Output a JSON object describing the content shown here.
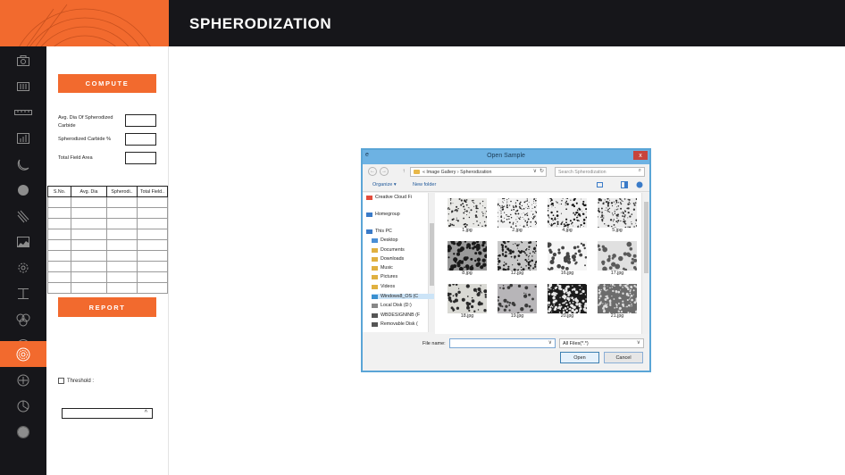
{
  "header": {
    "title": "SPHERODIZATION"
  },
  "colors": {
    "accent": "#f26a2e",
    "dark": "#16161a"
  },
  "rail": {
    "items": [
      {
        "name": "camera-icon"
      },
      {
        "name": "sliders-icon"
      },
      {
        "name": "ruler-icon"
      },
      {
        "name": "bar-chart-icon"
      },
      {
        "name": "crescent-icon"
      },
      {
        "name": "filled-circle-icon"
      },
      {
        "name": "diagonal-lines-icon"
      },
      {
        "name": "area-chart-icon"
      },
      {
        "name": "gear-icon"
      },
      {
        "name": "measure-icon"
      },
      {
        "name": "circles-icon"
      },
      {
        "name": "ring-circle-icon"
      },
      {
        "name": "spheroid-icon",
        "active": true
      },
      {
        "name": "crosshair-icon"
      },
      {
        "name": "pie-chart-icon"
      },
      {
        "name": "dot-circle-icon"
      }
    ]
  },
  "panel": {
    "compute_label": "COMPUTE",
    "avg_dia_label": "Avg. Dia Of Spherodized Carbide",
    "carbide_pct_label": "Spherodized Carbide %",
    "total_field_label": "Total Field Area",
    "table": {
      "headers": [
        "S.No.",
        "Avg. Dia",
        "Spherodi..",
        "Total Field.."
      ],
      "rows": [
        [
          "",
          "",
          "",
          ""
        ],
        [
          "",
          "",
          "",
          ""
        ],
        [
          "",
          "",
          "",
          ""
        ],
        [
          "",
          "",
          "",
          ""
        ],
        [
          "",
          "",
          "",
          ""
        ],
        [
          "",
          "",
          "",
          ""
        ],
        [
          "",
          "",
          "",
          ""
        ],
        [
          "",
          "",
          "",
          ""
        ],
        [
          "",
          "",
          "",
          ""
        ]
      ]
    },
    "report_label": "REPORT",
    "threshold_label": "Threshold :",
    "combo_caret": "^"
  },
  "dialog": {
    "title": "Open Sample",
    "system_glyph": "e",
    "close_label": "x",
    "nav": {
      "back": "←",
      "forward": "→",
      "up": "↑"
    },
    "address": "«  Image Gallery  ›  Spherodization",
    "address_dropdown": "∨",
    "address_refresh": "↻",
    "search_placeholder": "Search Spherodization",
    "search_icon": "⌕",
    "organize_label": "Organize ▾",
    "new_folder_label": "New folder",
    "tree": [
      {
        "label": "Creative Cloud Fi",
        "icon": "cloud-icon",
        "color": "#e34c3c"
      },
      {
        "label": "Homegroup",
        "icon": "homegroup-icon",
        "color": "#3a7bc8"
      },
      {
        "label": "This PC",
        "icon": "computer-icon",
        "color": "#3a7bc8"
      },
      {
        "label": "Desktop",
        "icon": "folder-icon",
        "color": "#4a8fd6"
      },
      {
        "label": "Documents",
        "icon": "folder-icon",
        "color": "#e0b040"
      },
      {
        "label": "Downloads",
        "icon": "folder-icon",
        "color": "#e0b040"
      },
      {
        "label": "Music",
        "icon": "folder-icon",
        "color": "#e0b040"
      },
      {
        "label": "Pictures",
        "icon": "folder-icon",
        "color": "#e0b040"
      },
      {
        "label": "Videos",
        "icon": "folder-icon",
        "color": "#e0b040"
      },
      {
        "label": "Windows8_OS (C",
        "icon": "drive-icon",
        "color": "#3a8fd0",
        "selected": true
      },
      {
        "label": "Local Disk (D:)",
        "icon": "drive-icon",
        "color": "#888888"
      },
      {
        "label": "WBDESIGNINB (F",
        "icon": "drive-icon",
        "color": "#555555"
      },
      {
        "label": "Removable Disk (",
        "icon": "drive-icon",
        "color": "#555555"
      }
    ],
    "files": [
      {
        "name": "1.jpg"
      },
      {
        "name": "2.jpg"
      },
      {
        "name": "4.jpg"
      },
      {
        "name": "5.jpg"
      },
      {
        "name": "8.jpg"
      },
      {
        "name": "12.jpg"
      },
      {
        "name": "16.jpg"
      },
      {
        "name": "17.jpg"
      },
      {
        "name": "18.jpg"
      },
      {
        "name": "19.jpg"
      },
      {
        "name": "20.jpg"
      },
      {
        "name": "21.jpg"
      }
    ],
    "file_name_label": "File name:",
    "file_name_value": "",
    "file_type_value": "All Files(*.*)",
    "open_label": "Open",
    "cancel_label": "Cancel"
  }
}
